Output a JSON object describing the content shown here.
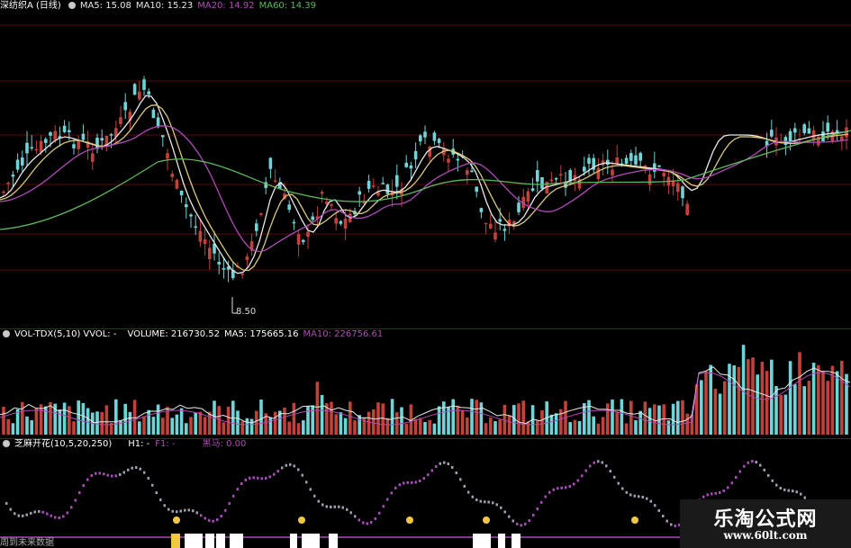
{
  "colors": {
    "up": "#c2413b",
    "down": "#6fd4d8",
    "ma5": "#e8e8e8",
    "ma10": "#d9c97a",
    "ma20": "#b04ab8",
    "ma60": "#5cb85c",
    "grid": "#5a0a0a",
    "separator": "#7a1010",
    "ind_purple": "#a64bb8",
    "ind_gray": "#9aa0b0",
    "marker": "#f2c744",
    "white_bar": "#ffffff"
  },
  "price_panel": {
    "title": "深纺织A (日线)",
    "ma5_label": "MA5: 15.08",
    "ma10_label": "MA10: 15.23",
    "ma20_label": "MA20: 14.92",
    "ma60_label": "MA60: 14.39",
    "low_label": "8.50"
  },
  "volume_panel": {
    "title": "VOL-TDX(5,10)",
    "vvol_label": "VVOL: -",
    "volume_label": "VOLUME: 216730.52",
    "ma5_label": "MA5: 175665.16",
    "ma10_label": "MA10: 226756.61"
  },
  "indicator_panel": {
    "title": "芝麻开花(10,5,20,250)",
    "h1_label": "H1: -",
    "f1_label": "F1: -",
    "heima_label": "黑马: 0.00",
    "future_note": "周到未来数据"
  },
  "watermark": {
    "title": "乐淘公式网",
    "url": "www.60lt.com"
  },
  "chart_data": {
    "type": "candlestick",
    "ma_labels": [
      "MA5",
      "MA10",
      "MA20",
      "MA60"
    ],
    "latest_ma": [
      15.08,
      15.23,
      14.92,
      14.39
    ],
    "low_annotation": 8.5,
    "latest_volume": 216730.52,
    "volume_ma5": 175665.16,
    "volume_ma10": 226756.61,
    "indicator_value_heima": 0.0
  }
}
